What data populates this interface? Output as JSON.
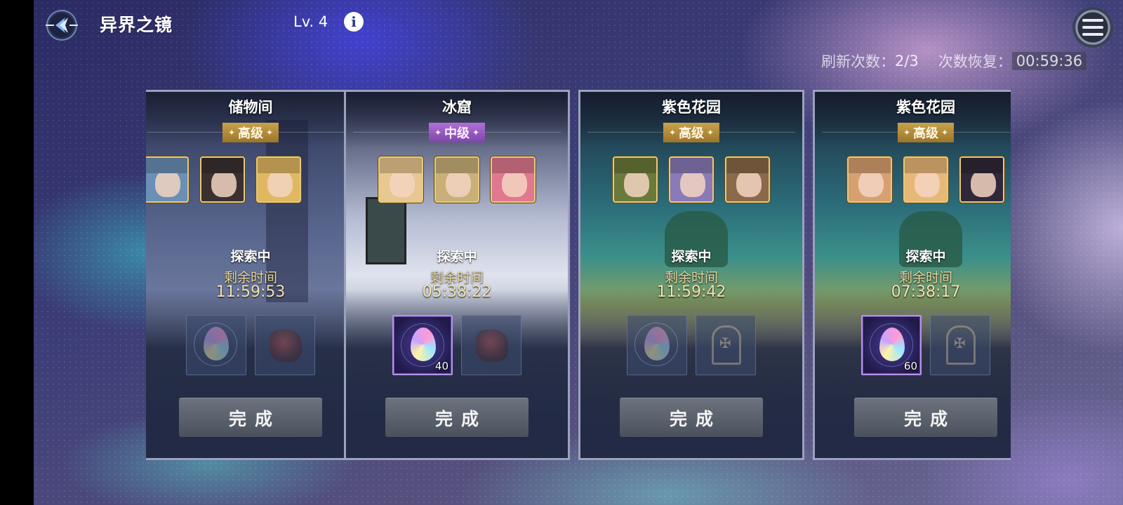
{
  "header": {
    "title": "异界之镜",
    "level": "Lv. 4",
    "info_icon": "info-icon",
    "back_icon": "back-arrow-icon",
    "menu_icon": "menu-icon"
  },
  "refresh": {
    "label": "刷新次数：",
    "value": "2/3",
    "recover_label": "次数恢复：",
    "recover_timer": "00:59:36"
  },
  "cards": [
    {
      "title": "储物间",
      "tier": "高级",
      "tier_color": "#b68c3a",
      "status": "探索中",
      "remain_label": "剩余时间",
      "remain_time": "11:59:53",
      "rewards": [
        {
          "icon": "rainbow-crystal-icon",
          "count": "",
          "active": false
        },
        {
          "icon": "red-ore-icon",
          "count": "",
          "active": false
        }
      ],
      "button": "完成"
    },
    {
      "title": "冰窟",
      "tier": "中级",
      "tier_color": "#9a5cc6",
      "status": "探索中",
      "remain_label": "剩余时间",
      "remain_time": "05:38:22",
      "rewards": [
        {
          "icon": "rainbow-crystal-icon",
          "count": "40",
          "active": true
        },
        {
          "icon": "red-ore-icon",
          "count": "",
          "active": false
        }
      ],
      "button": "完成"
    },
    {
      "title": "紫色花园",
      "tier": "高级",
      "tier_color": "#b68c3a",
      "status": "探索中",
      "remain_label": "剩余时间",
      "remain_time": "11:59:42",
      "rewards": [
        {
          "icon": "rainbow-crystal-icon",
          "count": "",
          "active": false
        },
        {
          "icon": "relic-cabinet-icon",
          "count": "",
          "active": false
        }
      ],
      "button": "完成"
    },
    {
      "title": "紫色花园",
      "tier": "高级",
      "tier_color": "#b68c3a",
      "status": "探索中",
      "remain_label": "剩余时间",
      "remain_time": "07:38:17",
      "rewards": [
        {
          "icon": "rainbow-crystal-icon",
          "count": "60",
          "active": true
        },
        {
          "icon": "relic-cabinet-icon",
          "count": "",
          "active": false
        }
      ],
      "button": "完成"
    }
  ]
}
